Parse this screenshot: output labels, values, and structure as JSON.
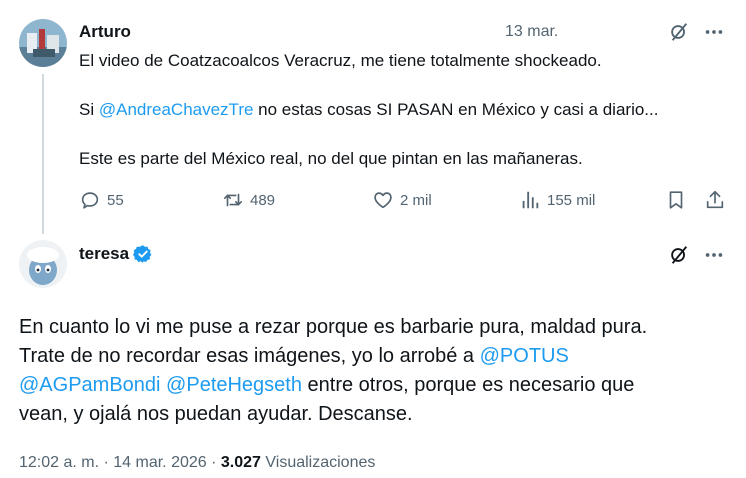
{
  "tweet1": {
    "author_name": "Arturo",
    "time": "13 mar.",
    "lines": [
      "El video de Coatzacoalcos Veracruz, me tiene totalmente shockeado.",
      "Si ",
      "@AndreaChavezTre",
      " no estas cosas SI PASAN en México y casi a diario...",
      "Este es parte del México real, no del que pintan en las mañaneras."
    ],
    "actions": {
      "replies": "55",
      "reposts": "489",
      "likes": "2 mil",
      "views": "155 mil"
    }
  },
  "tweet2": {
    "author_name": "teresa",
    "verified": true,
    "body_lines": [
      "En cuanto lo vi me puse a rezar porque es barbarie pura, maldad pura.",
      "Trate de no recordar esas imágenes, yo lo arrobé a ",
      "@POTUS",
      "@AGPamBondi",
      " ",
      "@PeteHegseth",
      " entre otros, porque es necesario que",
      "vean, y ojalá nos puedan ayudar. Descanse."
    ],
    "timestamp": "12:02 a. m. · 14 mar. 2026 · ",
    "view_count": "3.027",
    "views_label": " Visualizaciones"
  },
  "colors": {
    "accent": "#1d9bf0",
    "secondary_text": "#536471",
    "primary_text": "#0f1419",
    "thread_line": "#cfd9de"
  },
  "icons": [
    "grok-icon",
    "more-icon",
    "reply-icon",
    "repost-icon",
    "like-icon",
    "views-icon",
    "bookmark-icon",
    "share-icon",
    "verified-badge-icon"
  ]
}
